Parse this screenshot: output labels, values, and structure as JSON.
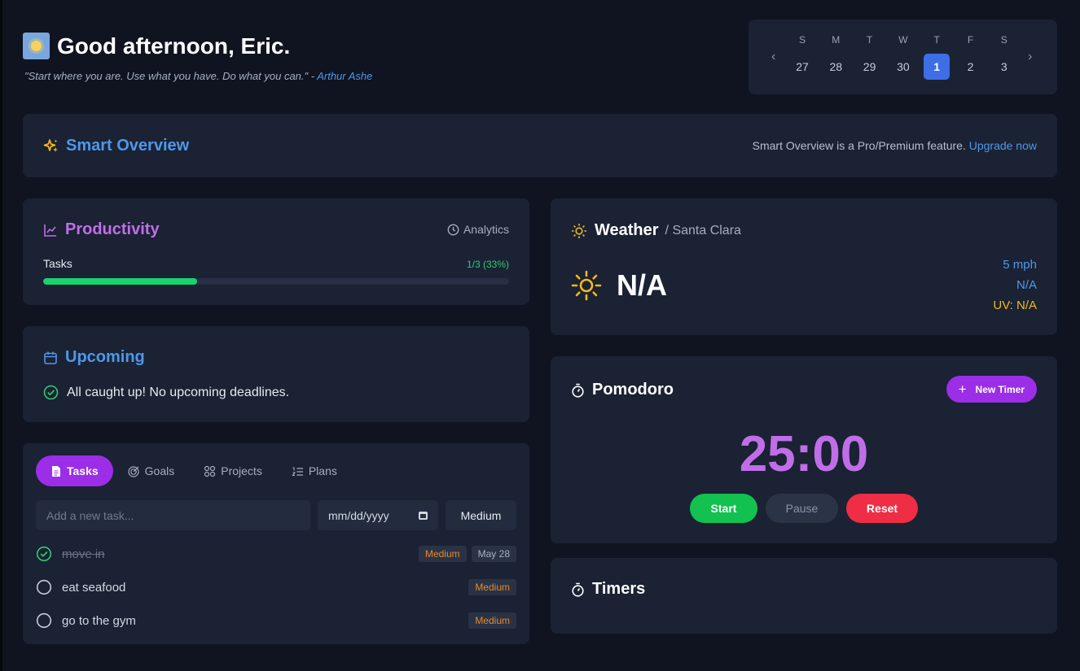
{
  "header": {
    "greeting": "Good afternoon, Eric.",
    "quote_text": "\"Start where you are. Use what you have. Do what you can.\" -",
    "quote_author": "Arthur Ashe"
  },
  "calendar": {
    "prev_icon": "chevron-left-icon",
    "next_icon": "chevron-right-icon",
    "weekdays": [
      "S",
      "M",
      "T",
      "W",
      "T",
      "F",
      "S"
    ],
    "days": [
      "27",
      "28",
      "29",
      "30",
      "1",
      "2",
      "3"
    ],
    "selected_day": "1"
  },
  "smart_overview": {
    "title": "Smart Overview",
    "note": "Smart Overview is a Pro/Premium feature.",
    "link": "Upgrade now"
  },
  "productivity": {
    "title": "Productivity",
    "analytics_label": "Analytics",
    "tasks_label": "Tasks",
    "tasks_value": "1/3 (33%)",
    "progress_fraction": 0.33
  },
  "upcoming": {
    "title": "Upcoming",
    "message": "All caught up! No upcoming deadlines."
  },
  "tasks_panel": {
    "tabs": [
      {
        "label": "Tasks",
        "active": true
      },
      {
        "label": "Goals",
        "active": false
      },
      {
        "label": "Projects",
        "active": false
      },
      {
        "label": "Plans",
        "active": false
      }
    ],
    "new_task_placeholder": "Add a new task...",
    "date_placeholder": "mm/dd/yyyy",
    "priority_value": "Medium",
    "items": [
      {
        "text": "move in",
        "done": true,
        "priority": "Medium",
        "due": "May 28"
      },
      {
        "text": "eat seafood",
        "done": false,
        "priority": "Medium",
        "due": ""
      },
      {
        "text": "go to the gym",
        "done": false,
        "priority": "Medium",
        "due": ""
      }
    ]
  },
  "weather": {
    "title": "Weather",
    "location": "/ Santa Clara",
    "temperature": "N/A",
    "wind": "5 mph",
    "humidity": "N/A",
    "uv": "UV: N/A"
  },
  "pomodoro": {
    "title": "Pomodoro",
    "new_timer_label": "New Timer",
    "time": "25:00",
    "start_label": "Start",
    "pause_label": "Pause",
    "reset_label": "Reset"
  },
  "timers": {
    "title": "Timers"
  },
  "colors": {
    "background": "#0f1420",
    "card": "#1a2234",
    "accent_purple": "#9b2ee6",
    "accent_blue": "#4f97ea",
    "success_green": "#12c14f",
    "danger_red": "#ef2d45",
    "priority_orange": "#e48b2c",
    "uv_yellow": "#f2b81e"
  }
}
